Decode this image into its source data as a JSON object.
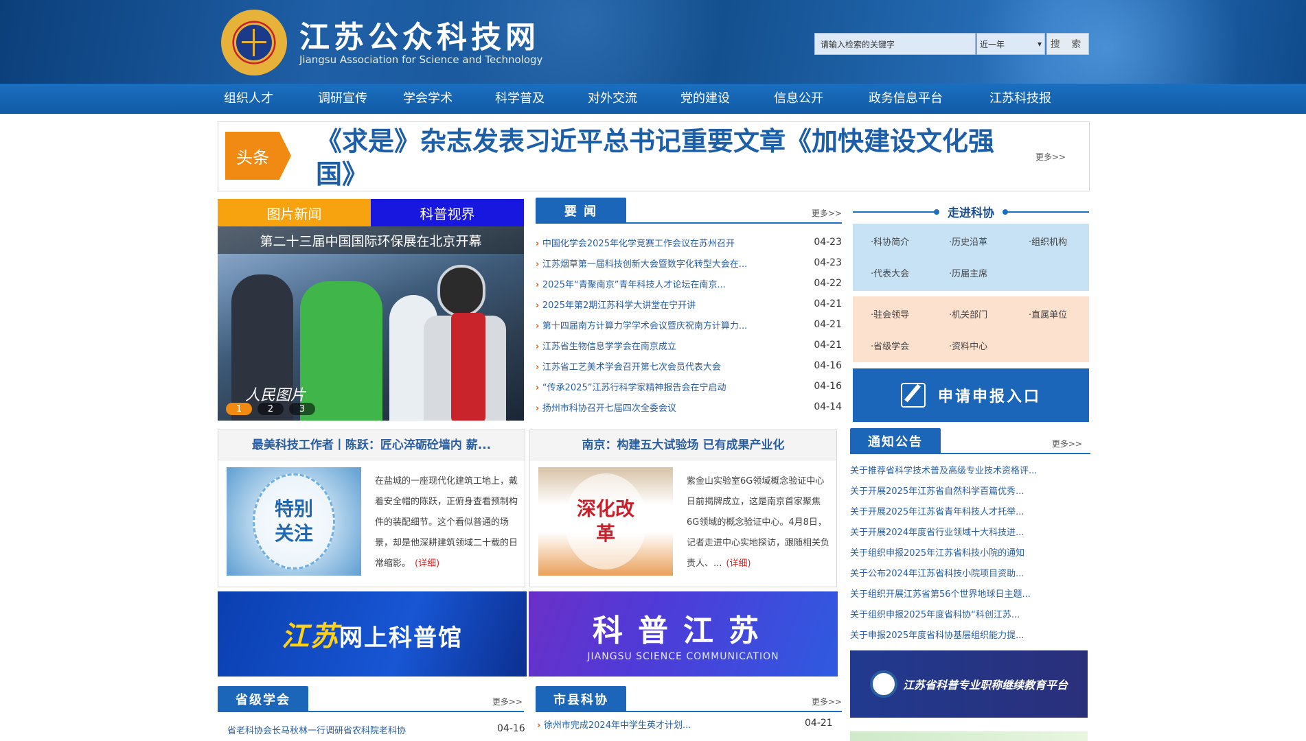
{
  "header": {
    "title": "江苏公众科技网",
    "subtitle": "Jiangsu Association for Science and Technology",
    "search_placeholder": "请输入检索的关键字",
    "year_option": "近一年",
    "search_button": "搜 索"
  },
  "nav": [
    "组织人才",
    "调研宣传",
    "学会学术",
    "科学普及",
    "对外交流",
    "党的建设",
    "信息公开",
    "政务信息平台",
    "江苏科技报"
  ],
  "headline": {
    "tag": "头条",
    "text": "《求是》杂志发表习近平总书记重要文章《加快建设文化强国》",
    "more": "更多>>"
  },
  "picture_news": {
    "tabs": [
      "图片新闻",
      "科普视界"
    ],
    "caption": "第二十三届中国国际环保展在北京开幕",
    "watermark": "人民图片",
    "dots": [
      "1",
      "2",
      "3"
    ]
  },
  "important_news": {
    "title": "要 闻",
    "more": "更多>>",
    "items": [
      {
        "title": "中国化学会2025年化学竞赛工作会议在苏州召开",
        "date": "04-23"
      },
      {
        "title": "江苏烟草第一届科技创新大会暨数字化转型大会在...",
        "date": "04-23"
      },
      {
        "title": "2025年“青聚南京”青年科技人才论坛在南京...",
        "date": "04-22"
      },
      {
        "title": "2025年第2期江苏科学大讲堂在宁开讲",
        "date": "04-21"
      },
      {
        "title": "第十四届南方计算力学学术会议暨庆祝南方计算力...",
        "date": "04-21"
      },
      {
        "title": "江苏省生物信息学学会在南京成立",
        "date": "04-21"
      },
      {
        "title": "江苏省工艺美术学会召开第七次会员代表大会",
        "date": "04-16"
      },
      {
        "title": "“传承2025”江苏行科学家精神报告会在宁启动",
        "date": "04-16"
      },
      {
        "title": "扬州市科协召开七届四次全委会议",
        "date": "04-14"
      }
    ]
  },
  "about": {
    "title": "走进科协",
    "group1": [
      "·科协简介",
      "·历史沿革",
      "·组织机构",
      "·代表大会",
      "·历届主席"
    ],
    "group2": [
      "·驻会领导",
      "·机关部门",
      "·直属单位",
      "·省级学会",
      "·资料中心"
    ]
  },
  "apply": {
    "label": "申请申报入口"
  },
  "notices": {
    "title": "通知公告",
    "more": "更多>>",
    "items": [
      "关于推荐省科学技术普及高级专业技术资格评...",
      "关于开展2025年江苏省自然科学百篇优秀...",
      "关于开展2025年江苏省青年科技人才托举...",
      "关于开展2024年度省行业领域十大科技进...",
      "关于组织申报2025年江苏省科技小院的通知",
      "关于公布2024年江苏省科技小院项目资助...",
      "关于组织开展江苏省第56个世界地球日主题...",
      "关于组织申报2025年度省科协“科创江苏...",
      "关于申报2025年度省科协基层组织能力提..."
    ]
  },
  "cards": [
    {
      "title": "最美科技工作者丨陈跃：匠心淬砺砼墙内 薪...",
      "image_text": "特别关注",
      "body": "在盐城的一座现代化建筑工地上，戴着安全帽的陈跃，正俯身查看预制构件的装配细节。这个看似普通的场景，却是他深耕建筑领域二十载的日常缩影。",
      "detail": "(详细)"
    },
    {
      "title": "南京：构建五大试验场 已有成果产业化",
      "image_text": "深化改革",
      "body": "紫金山实验室6G领域概念验证中心日前揭牌成立，这是南京首家聚焦6G领域的概念验证中心。4月8日，记者走进中心实地探访，跟随相关负责人、...",
      "detail": "(详细)"
    }
  ],
  "banners": {
    "b1_main": "江苏",
    "b1_rest": "网上科普馆",
    "b2_main": "科普江苏",
    "b2_sub": "JIANGSU SCIENCE COMMUNICATION"
  },
  "provincial": {
    "title": "省级学会",
    "more": "更多>>",
    "items": [
      {
        "title": "省老科协会长马秋林一行调研省农科院老科协",
        "date": "04-16"
      }
    ]
  },
  "city": {
    "title": "市县科协",
    "more": "更多>>",
    "items": [
      {
        "title": "徐州市完成2024年中学生英才计划...",
        "date": "04-21"
      }
    ]
  },
  "edu_banner": {
    "text": "江苏省科普专业职称继续教育平台"
  },
  "colors": {
    "nav_blue": "#1b66b8",
    "accent_orange": "#f08a12",
    "link_blue": "#2a5ea0"
  }
}
